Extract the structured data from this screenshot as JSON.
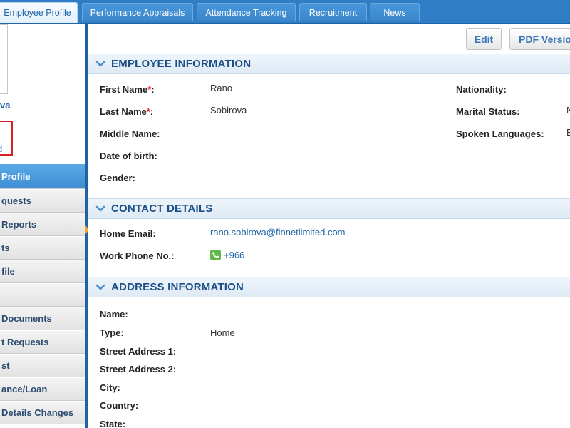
{
  "tabs": [
    {
      "label": "Employee Profile",
      "active": true
    },
    {
      "label": "Performance Appraisals"
    },
    {
      "label": "Attendance Tracking"
    },
    {
      "label": "Recruitment"
    },
    {
      "label": "News"
    }
  ],
  "sidebar": {
    "employee_name_fragment": "va",
    "box_link_fragment": "d",
    "menu": [
      {
        "label": "Profile",
        "active": true
      },
      {
        "label": "quests"
      },
      {
        "label": "Reports"
      },
      {
        "label": "ts"
      },
      {
        "label": "file"
      },
      {
        "label": ""
      },
      {
        "label": "Documents"
      },
      {
        "label": "t Requests"
      },
      {
        "label": "st"
      },
      {
        "label": "ance/Loan"
      },
      {
        "label": "Details Changes"
      }
    ]
  },
  "toolbar": {
    "edit_label": "Edit",
    "pdf_label": "PDF Version"
  },
  "employee_information": {
    "title": "EMPLOYEE INFORMATION",
    "first_name_label": "First Name",
    "first_name": "Rano",
    "last_name_label": "Last Name",
    "last_name": "Sobirova",
    "middle_name_label": "Middle Name:",
    "dob_label": "Date of birth:",
    "gender_label": "Gender:",
    "nationality_label": "Nationality:",
    "marital_status_label": "Marital Status:",
    "marital_status_fragment": "N",
    "spoken_languages_label": "Spoken Languages:",
    "spoken_languages_fragment": "E"
  },
  "contact_details": {
    "title": "CONTACT DETAILS",
    "home_email_label": "Home Email:",
    "home_email": "rano.sobirova@finnetlimited.com",
    "work_phone_label": "Work Phone No.:",
    "work_phone": "+966"
  },
  "address_information": {
    "title": "ADDRESS INFORMATION",
    "name_label": "Name:",
    "type_label": "Type:",
    "type_value": "Home",
    "street1_label": "Street Address 1:",
    "street2_label": "Street Address 2:",
    "city_label": "City:",
    "country_label": "Country:",
    "state_label": "State:"
  },
  "colors": {
    "tabbar": "#2f7dc4",
    "section_title": "#1d4f86",
    "link": "#1f64a8",
    "required": "#e02020",
    "sidebar_active": "#3d8ed3"
  },
  "icons": {
    "section_toggle": "chevron-down-icon",
    "phone": "phone-icon"
  }
}
